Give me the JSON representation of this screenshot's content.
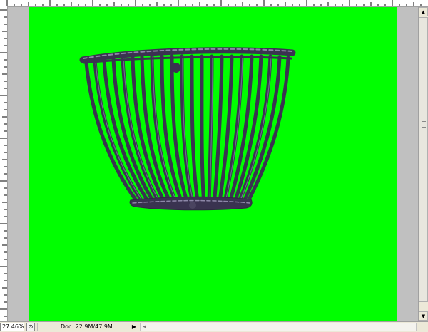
{
  "status_bar": {
    "zoom_level": "27.46%",
    "doc_info": "Doc: 22.9M/47.9M",
    "menu_arrow": "▶"
  },
  "scrollbars": {
    "vertical_up": "▲",
    "vertical_down": "▼",
    "horizontal_left": "◀"
  },
  "canvas": {
    "background": "#00ff00",
    "subject": "woven-wire-basket"
  },
  "colors": {
    "basket": "#3a3350",
    "basket_highlight": "#8d87a8",
    "pasteboard": "#c0c0c0",
    "chrome": "#ece9d8"
  }
}
